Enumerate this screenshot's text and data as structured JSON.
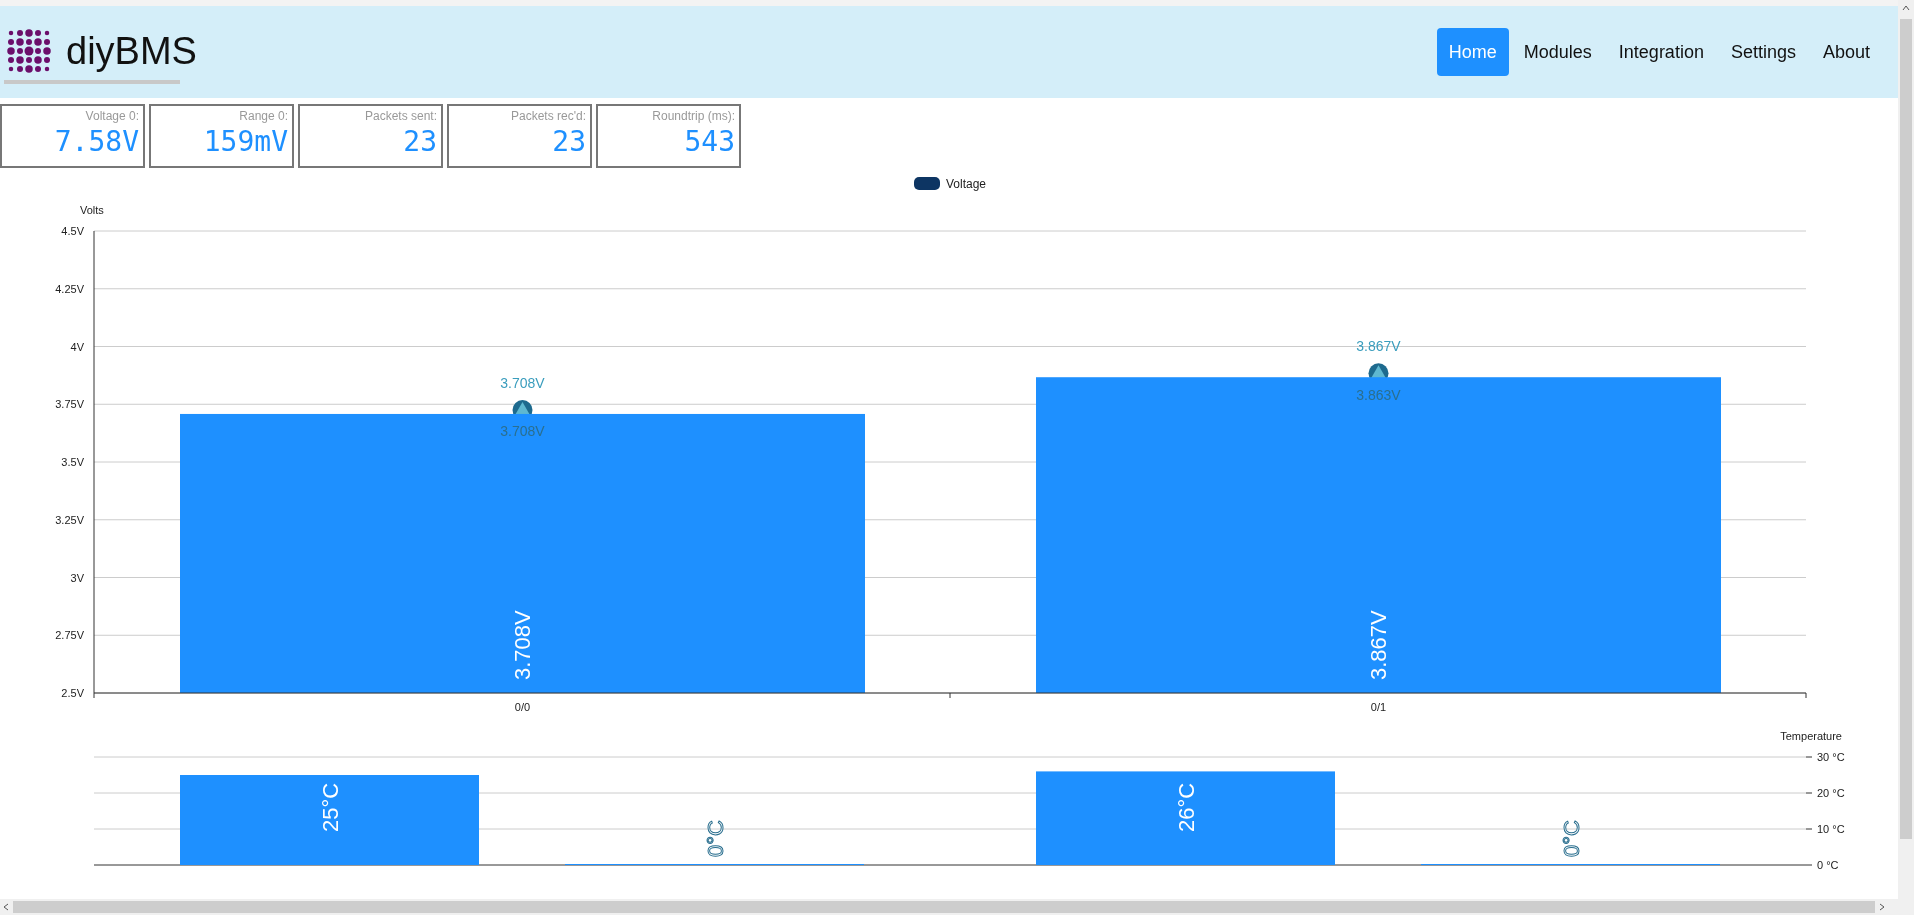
{
  "header": {
    "brand": "diyBMS",
    "nav": [
      {
        "label": "Home",
        "selected": true
      },
      {
        "label": "Modules",
        "selected": false
      },
      {
        "label": "Integration",
        "selected": false
      },
      {
        "label": "Settings",
        "selected": false
      },
      {
        "label": "About",
        "selected": false
      }
    ]
  },
  "stats": [
    {
      "label": "Voltage 0:",
      "value": "7.58V"
    },
    {
      "label": "Range 0:",
      "value": "159mV"
    },
    {
      "label": "Packets sent:",
      "value": "23"
    },
    {
      "label": "Packets rec'd:",
      "value": "23"
    },
    {
      "label": "Roundtrip (ms):",
      "value": "543"
    }
  ],
  "voltage_chart": {
    "legend": {
      "color": "#0d3563"
    },
    "chart_data": {
      "type": "bar",
      "ylabel": "Volts",
      "categories": [
        "0/0",
        "0/1"
      ],
      "grid": true,
      "series": [
        {
          "name": "Voltage",
          "color": "#1e90ff",
          "values": [
            3.708,
            3.867
          ]
        }
      ],
      "ylim": [
        2.5,
        4.5
      ],
      "yticks": [
        {
          "value": 2.5,
          "label": "2.5V"
        },
        {
          "value": 2.75,
          "label": "2.75V"
        },
        {
          "value": 3,
          "label": "3V"
        },
        {
          "value": 3.25,
          "label": "3.25V"
        },
        {
          "value": 3.5,
          "label": "3.5V"
        },
        {
          "value": 3.75,
          "label": "3.75V"
        },
        {
          "value": 4,
          "label": "4V"
        },
        {
          "value": 4.25,
          "label": "4.25V"
        },
        {
          "value": 4.5,
          "label": "4.5V"
        }
      ],
      "value_labels": [
        "3.708V",
        "3.867V"
      ],
      "annotations": [
        {
          "x": "0/0",
          "y": 3.708,
          "text": "3.708V"
        },
        {
          "x": "0/0",
          "y": 3.708,
          "text": "3.708V"
        },
        {
          "x": "0/1",
          "y": 3.867,
          "text": "3.867V"
        },
        {
          "x": "0/1",
          "y": 3.863,
          "text": "3.863V"
        }
      ]
    }
  },
  "temperature_chart": {
    "chart_data": {
      "type": "bar",
      "ylabel": "Temperature",
      "grid": true,
      "series": [
        {
          "color": "#1e90ff",
          "values": [
            25,
            26
          ],
          "value_labels": [
            "25°C",
            "26°C"
          ]
        },
        {
          "color": "#1e90ff",
          "values": [
            0,
            0
          ],
          "value_labels": [
            "0°C",
            "0°C"
          ]
        }
      ],
      "ylim": [
        0,
        30
      ],
      "yticks": [
        {
          "value": 0,
          "label": "0 °C"
        },
        {
          "value": 10,
          "label": "10 °C"
        },
        {
          "value": 20,
          "label": "20 °C"
        },
        {
          "value": 30,
          "label": "30 °C"
        }
      ]
    }
  }
}
